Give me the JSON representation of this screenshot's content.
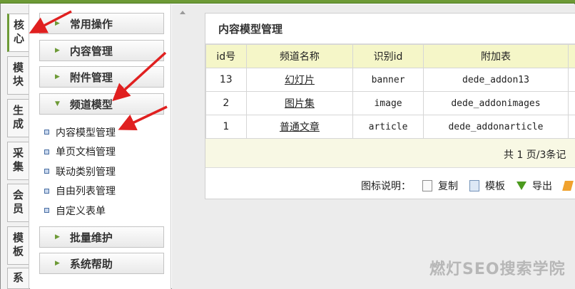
{
  "vertical_tabs": [
    {
      "label": "核心",
      "active": true
    },
    {
      "label": "模块",
      "active": false
    },
    {
      "label": "生成",
      "active": false
    },
    {
      "label": "采集",
      "active": false
    },
    {
      "label": "会员",
      "active": false
    },
    {
      "label": "模板",
      "active": false
    },
    {
      "label": "系",
      "active": false
    }
  ],
  "sidebar": {
    "menus": [
      {
        "label": "常用操作",
        "expanded": false
      },
      {
        "label": "内容管理",
        "expanded": false
      },
      {
        "label": "附件管理",
        "expanded": false
      },
      {
        "label": "频道模型",
        "expanded": true
      },
      {
        "label": "批量维护",
        "expanded": false
      },
      {
        "label": "系统帮助",
        "expanded": false
      }
    ],
    "channel_items": [
      {
        "label": "内容模型管理"
      },
      {
        "label": "单页文档管理"
      },
      {
        "label": "联动类别管理"
      },
      {
        "label": "自由列表管理"
      },
      {
        "label": "自定义表单"
      }
    ]
  },
  "main": {
    "panel_title": "内容模型管理",
    "table": {
      "headers": [
        "id号",
        "频道名称",
        "识别id",
        "附加表"
      ],
      "rows": [
        {
          "id": "13",
          "name": "幻灯片",
          "ident": "banner",
          "addtable": "dede_addon13"
        },
        {
          "id": "2",
          "name": "图片集",
          "ident": "image",
          "addtable": "dede_addonimages"
        },
        {
          "id": "1",
          "name": "普通文章",
          "ident": "article",
          "addtable": "dede_addonarticle"
        }
      ]
    },
    "pager": "共 1 页/3条记",
    "legend": {
      "label": "图标说明：",
      "items": [
        {
          "icon": "copy-icon",
          "label": "复制"
        },
        {
          "icon": "template-icon",
          "label": "模板"
        },
        {
          "icon": "export-icon",
          "label": "导出"
        }
      ]
    }
  },
  "watermark": "燃灯SEO搜索学院",
  "colors": {
    "accent_green": "#6d9a36",
    "table_header_bg": "#f5f6c8",
    "annotation_arrow": "#e02020"
  }
}
